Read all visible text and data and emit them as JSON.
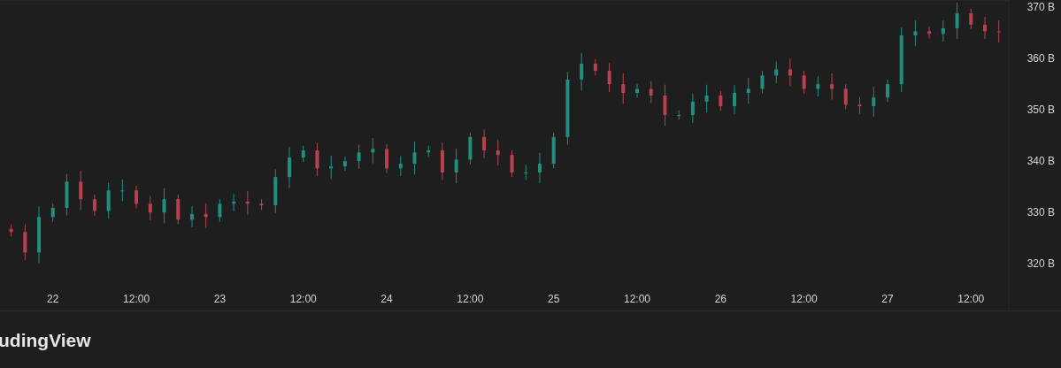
{
  "chart_data": {
    "type": "candlestick",
    "ylim": [
      310.9,
      371.4
    ],
    "yticks": [
      {
        "value": 320,
        "label": "320 B"
      },
      {
        "value": 330,
        "label": "330 B"
      },
      {
        "value": 340,
        "label": "340 B"
      },
      {
        "value": 350,
        "label": "350 B"
      },
      {
        "value": 360,
        "label": "360 B"
      },
      {
        "value": 370,
        "label": "370 B"
      }
    ],
    "categories": [
      null,
      null,
      null,
      "22",
      null,
      null,
      null,
      null,
      null,
      "12:00",
      null,
      null,
      null,
      null,
      null,
      "23",
      null,
      null,
      null,
      null,
      null,
      "12:00",
      null,
      null,
      null,
      null,
      null,
      "24",
      null,
      null,
      null,
      null,
      null,
      "12:00",
      null,
      null,
      null,
      null,
      null,
      "25",
      null,
      null,
      null,
      null,
      null,
      "12:00",
      null,
      null,
      null,
      null,
      null,
      "26",
      null,
      null,
      null,
      null,
      null,
      "12:00",
      null,
      null,
      null,
      null,
      null,
      "27",
      null,
      null,
      null,
      null,
      null,
      "12:00",
      null,
      null
    ],
    "ohlc": [
      [
        326.8,
        327.7,
        325.3,
        326.2
      ],
      [
        326.2,
        327.7,
        320.7,
        322.2
      ],
      [
        322.2,
        331.2,
        320.1,
        329.1
      ],
      [
        329.1,
        331.8,
        328.2,
        330.9
      ],
      [
        330.9,
        337.5,
        329.4,
        336.0
      ],
      [
        336.0,
        338.1,
        330.5,
        332.6
      ],
      [
        332.6,
        333.5,
        329.4,
        330.3
      ],
      [
        330.3,
        335.8,
        328.8,
        334.3
      ],
      [
        334.3,
        336.4,
        332.2,
        334.3
      ],
      [
        334.3,
        335.2,
        330.8,
        331.7
      ],
      [
        331.7,
        333.2,
        328.5,
        330.0
      ],
      [
        330.0,
        334.7,
        327.9,
        332.6
      ],
      [
        332.6,
        333.5,
        327.7,
        328.6
      ],
      [
        328.6,
        331.2,
        327.1,
        329.7
      ],
      [
        329.7,
        331.8,
        327.0,
        329.1
      ],
      [
        329.1,
        332.6,
        328.2,
        331.7
      ],
      [
        331.7,
        333.6,
        330.2,
        332.1
      ],
      [
        332.1,
        334.2,
        329.6,
        331.7
      ],
      [
        331.7,
        332.6,
        330.5,
        331.4
      ],
      [
        331.4,
        338.4,
        329.9,
        336.9
      ],
      [
        336.9,
        342.8,
        334.8,
        340.7
      ],
      [
        340.7,
        343.0,
        339.8,
        342.1
      ],
      [
        342.1,
        343.6,
        337.1,
        338.6
      ],
      [
        338.6,
        341.1,
        336.5,
        339.0
      ],
      [
        339.0,
        340.9,
        338.1,
        340.0
      ],
      [
        340.0,
        343.2,
        338.5,
        341.7
      ],
      [
        341.7,
        344.5,
        339.6,
        342.4
      ],
      [
        342.4,
        343.3,
        337.7,
        338.6
      ],
      [
        338.6,
        341.0,
        337.1,
        339.5
      ],
      [
        339.5,
        343.8,
        337.4,
        341.7
      ],
      [
        341.7,
        343.0,
        340.8,
        342.1
      ],
      [
        342.1,
        343.6,
        336.3,
        337.8
      ],
      [
        337.8,
        342.4,
        335.7,
        340.3
      ],
      [
        340.3,
        345.6,
        339.4,
        344.7
      ],
      [
        344.7,
        346.2,
        340.6,
        342.1
      ],
      [
        342.1,
        344.2,
        339.1,
        341.2
      ],
      [
        341.2,
        342.1,
        336.9,
        337.8
      ],
      [
        337.8,
        339.3,
        336.3,
        337.8
      ],
      [
        337.8,
        341.6,
        335.7,
        339.5
      ],
      [
        339.5,
        345.6,
        338.6,
        344.7
      ],
      [
        344.7,
        357.4,
        343.2,
        355.9
      ],
      [
        355.9,
        361.1,
        353.8,
        359.0
      ],
      [
        359.0,
        359.9,
        356.7,
        357.6
      ],
      [
        357.6,
        359.1,
        353.5,
        355.0
      ],
      [
        355.0,
        357.1,
        351.2,
        353.3
      ],
      [
        353.3,
        355.0,
        352.4,
        354.1
      ],
      [
        354.1,
        355.6,
        351.3,
        352.8
      ],
      [
        352.8,
        354.9,
        346.9,
        349.0
      ],
      [
        349.0,
        349.9,
        348.1,
        349.0
      ],
      [
        349.0,
        353.1,
        347.5,
        351.6
      ],
      [
        351.6,
        354.9,
        349.5,
        352.8
      ],
      [
        352.8,
        353.7,
        349.8,
        350.7
      ],
      [
        350.7,
        354.8,
        349.2,
        353.3
      ],
      [
        353.3,
        356.2,
        351.2,
        354.1
      ],
      [
        354.1,
        357.6,
        353.2,
        356.7
      ],
      [
        356.7,
        359.4,
        355.2,
        357.9
      ],
      [
        357.9,
        360.0,
        354.6,
        356.7
      ],
      [
        356.7,
        357.6,
        353.2,
        354.1
      ],
      [
        354.1,
        356.5,
        352.6,
        355.0
      ],
      [
        355.0,
        357.1,
        352.0,
        354.1
      ],
      [
        354.1,
        355.0,
        350.1,
        351.0
      ],
      [
        351.0,
        352.5,
        349.2,
        350.7
      ],
      [
        350.7,
        354.5,
        348.6,
        352.4
      ],
      [
        352.4,
        355.9,
        351.5,
        355.0
      ],
      [
        355.0,
        366.0,
        353.5,
        364.5
      ],
      [
        364.5,
        367.4,
        362.4,
        365.3
      ],
      [
        365.3,
        366.2,
        363.9,
        364.8
      ],
      [
        364.8,
        367.4,
        363.3,
        365.9
      ],
      [
        365.9,
        370.9,
        363.8,
        368.8
      ],
      [
        368.8,
        369.7,
        365.7,
        366.6
      ],
      [
        366.6,
        368.1,
        363.8,
        365.3
      ],
      [
        365.3,
        367.4,
        363.1,
        365.2
      ]
    ]
  },
  "brand": "udingView"
}
